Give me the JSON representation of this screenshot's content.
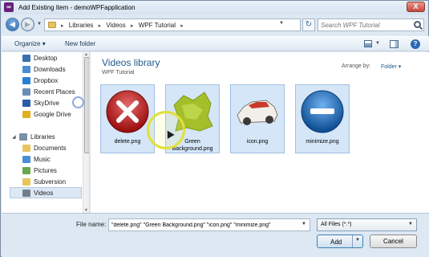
{
  "window": {
    "title": "Add Existing Item - demoWPFapplication",
    "close_label": "X"
  },
  "navigation": {
    "breadcrumb": [
      "Libraries",
      "Videos",
      "WPF Tutorial"
    ],
    "search_placeholder": "Search WPF Tutorial"
  },
  "toolbar": {
    "organize_label": "Organize",
    "new_folder_label": "New folder"
  },
  "nav_pane": {
    "favorites": [
      {
        "label": "Desktop",
        "icon": "desktop-icon",
        "color": "#3a6fb0"
      },
      {
        "label": "Downloads",
        "icon": "downloads-icon",
        "color": "#4a8fd4"
      },
      {
        "label": "Dropbox",
        "icon": "dropbox-icon",
        "color": "#2b7fd4"
      },
      {
        "label": "Recent Places",
        "icon": "recent-places-icon",
        "color": "#6b8fb4"
      },
      {
        "label": "SkyDrive",
        "icon": "skydrive-icon",
        "color": "#2a5da8"
      },
      {
        "label": "Google Drive",
        "icon": "google-drive-icon",
        "color": "#e0b020"
      }
    ],
    "libraries_label": "Libraries",
    "libraries": [
      {
        "label": "Documents",
        "icon": "documents-icon",
        "color": "#e7c45e"
      },
      {
        "label": "Music",
        "icon": "music-icon",
        "color": "#4a8fd4"
      },
      {
        "label": "Pictures",
        "icon": "pictures-icon",
        "color": "#6aa84f"
      },
      {
        "label": "Subversion",
        "icon": "subversion-icon",
        "color": "#e7c45e"
      },
      {
        "label": "Videos",
        "icon": "videos-icon",
        "color": "#6f7f90",
        "selected": true
      }
    ]
  },
  "content": {
    "library_title": "Videos library",
    "library_subtitle": "WPF Tutorial",
    "arrange_label": "Arrange by:",
    "arrange_value": "Folder",
    "files": [
      {
        "name": "delete.png",
        "icon": "delete-icon"
      },
      {
        "name": "Green Background.png",
        "icon": "green-background-icon"
      },
      {
        "name": "icon.png",
        "icon": "car-icon"
      },
      {
        "name": "minimize.png",
        "icon": "minimize-icon"
      }
    ]
  },
  "bottom": {
    "file_name_label": "File name:",
    "file_name_value": "\"delete.png\" \"Green Background.png\" \"icon.png\" \"minimize.png\"",
    "filter_value": "All Files (*.*)",
    "add_label": "Add",
    "cancel_label": "Cancel"
  },
  "colors": {
    "accent": "#1e5a8c",
    "selection": "#d5e6f8"
  }
}
